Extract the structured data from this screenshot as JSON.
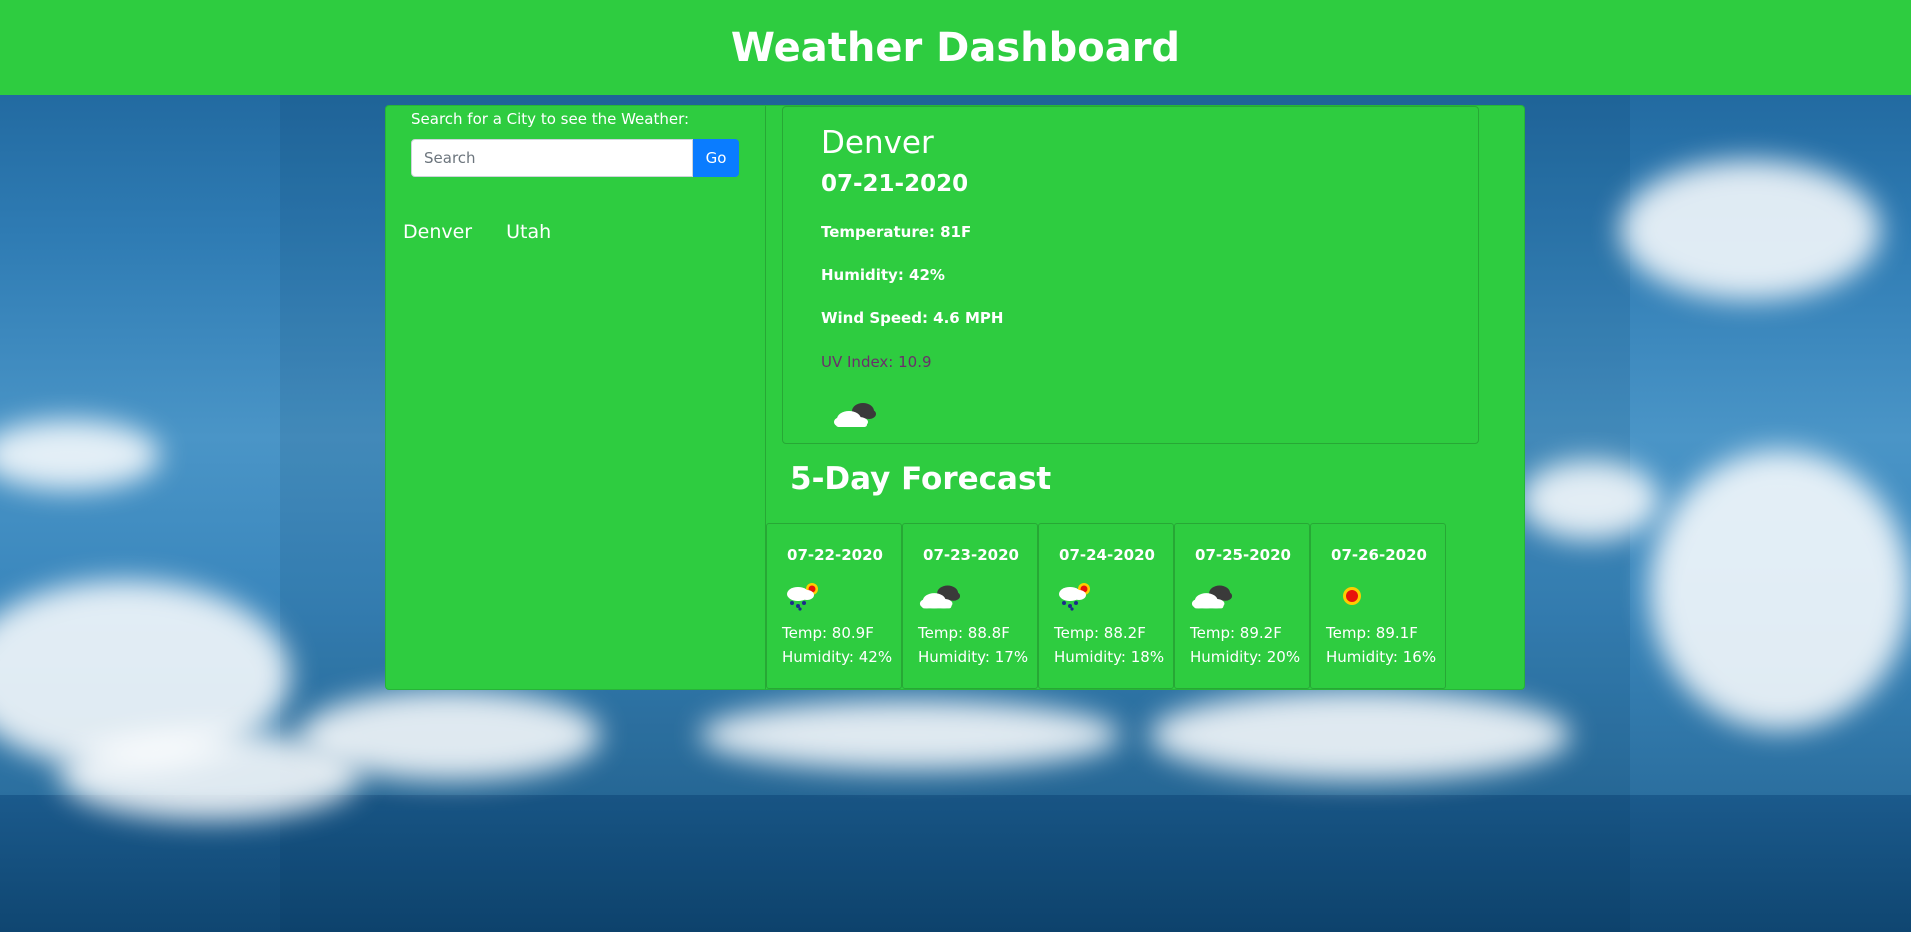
{
  "header": {
    "title": "Weather Dashboard"
  },
  "search": {
    "label": "Search for a City to see the Weather:",
    "placeholder": "Search",
    "value": "",
    "button_label": "Go"
  },
  "history": [
    "Denver",
    "Utah"
  ],
  "current": {
    "city": "Denver",
    "date": "07-21-2020",
    "temperature": "Temperature: 81F",
    "humidity": "Humidity: 42%",
    "wind": "Wind Speed: 4.6 MPH",
    "uv": "UV Index: 10.9",
    "icon": "cloudy-icon"
  },
  "forecast": {
    "title": "5-Day Forecast",
    "days": [
      {
        "date": "07-22-2020",
        "icon": "rain-sun-icon",
        "temp": "Temp: 80.9F",
        "humidity": "Humidity: 42%"
      },
      {
        "date": "07-23-2020",
        "icon": "cloudy-icon",
        "temp": "Temp: 88.8F",
        "humidity": "Humidity: 17%"
      },
      {
        "date": "07-24-2020",
        "icon": "rain-sun-icon",
        "temp": "Temp: 88.2F",
        "humidity": "Humidity: 18%"
      },
      {
        "date": "07-25-2020",
        "icon": "cloudy-icon",
        "temp": "Temp: 89.2F",
        "humidity": "Humidity: 20%"
      },
      {
        "date": "07-26-2020",
        "icon": "sun-icon",
        "temp": "Temp: 89.1F",
        "humidity": "Humidity: 16%"
      }
    ]
  },
  "colors": {
    "header_bg": "#2ecc40",
    "panel_bg": "#2ecc40",
    "button_bg": "#0a7cff",
    "uv_text": "#6b2f6b"
  }
}
